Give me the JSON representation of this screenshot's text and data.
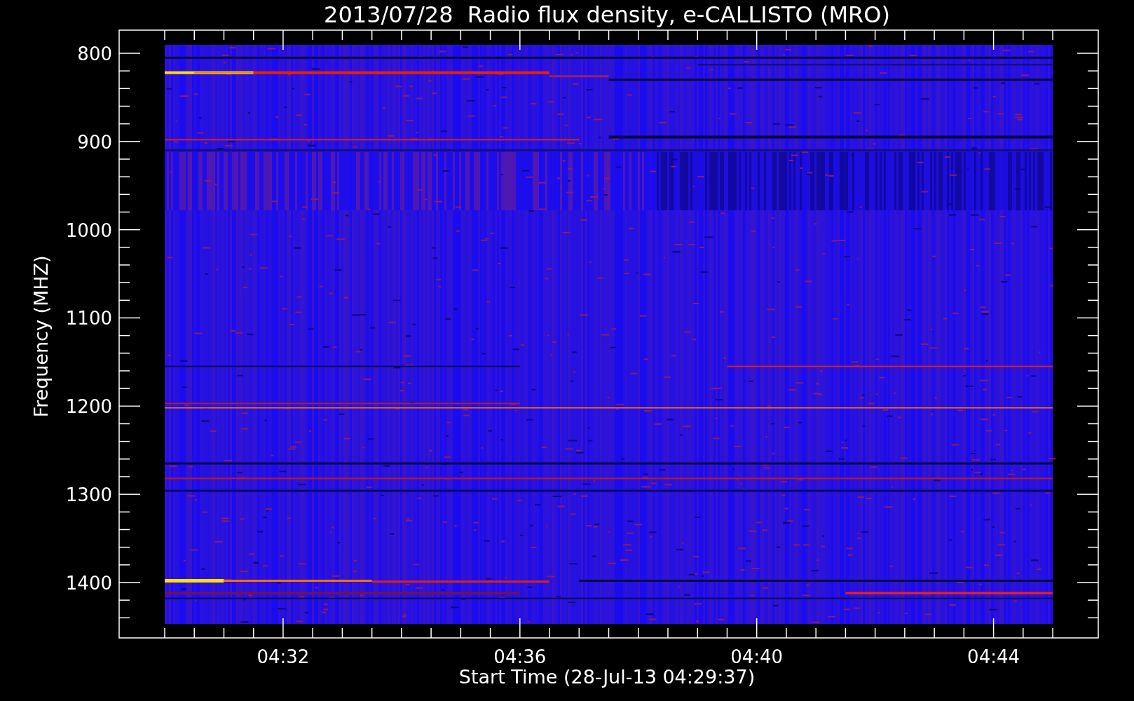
{
  "title": "2013/07/28  Radio flux density, e-CALLISTO (MRO)",
  "y_axis": {
    "label": "Frequency (MHZ)",
    "ticks": [
      "800",
      "900",
      "1000",
      "1100",
      "1200",
      "1300",
      "1400"
    ]
  },
  "x_axis": {
    "label": "Start Time (28-Jul-13 04:29:37)",
    "ticks": [
      "04:32",
      "04:36",
      "04:40",
      "04:44"
    ]
  }
}
